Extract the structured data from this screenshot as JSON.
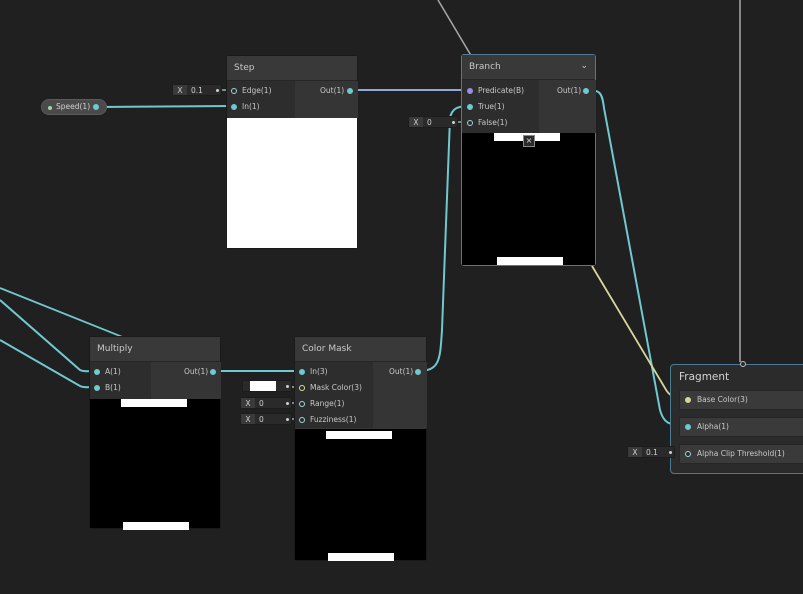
{
  "nodes": {
    "step": {
      "title": "Step",
      "inputs": [
        "Edge(1)",
        "In(1)"
      ],
      "output": "Out(1)",
      "edge_value": "0.1",
      "axis_label": "X"
    },
    "branch": {
      "title": "Branch",
      "inputs": [
        "Predicate(B)",
        "True(1)",
        "False(1)"
      ],
      "output": "Out(1)",
      "false_value": "0",
      "axis_label": "X"
    },
    "multiply": {
      "title": "Multiply",
      "inputs": [
        "A(1)",
        "B(1)"
      ],
      "output": "Out(1)"
    },
    "color_mask": {
      "title": "Color Mask",
      "inputs": [
        "In(3)",
        "Mask Color(3)",
        "Range(1)",
        "Fuzziness(1)"
      ],
      "output": "Out(1)",
      "range_value": "0",
      "fuzziness_value": "0",
      "axis_label": "X"
    },
    "fragment": {
      "title": "Fragment",
      "inputs": [
        "Base Color(3)",
        "Alpha(1)",
        "Alpha Clip Threshold(1)"
      ],
      "alpha_clip_value": "0.1",
      "axis_label": "X"
    }
  },
  "property": {
    "label": "Speed(1)"
  },
  "colors": {
    "background": "#202020",
    "wire_float": "#6fc9cf",
    "wire_vector3": "#d8d69a",
    "wire_bool": "#9b8ee0",
    "wire_grey": "#a8a8a8",
    "selection": "#4a7d94"
  }
}
